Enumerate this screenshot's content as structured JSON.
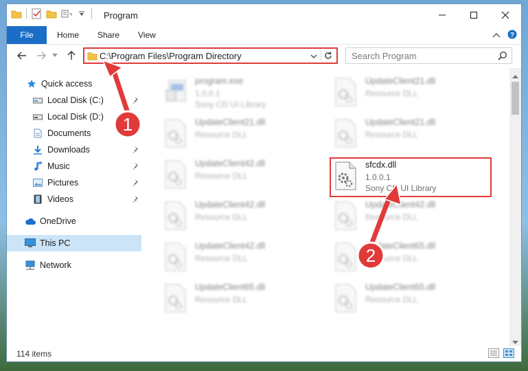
{
  "window": {
    "title": "Program"
  },
  "ribbon": {
    "tabs": [
      "File",
      "Home",
      "Share",
      "View"
    ]
  },
  "address": {
    "path": "C:\\Program Files\\Program Directory"
  },
  "search": {
    "placeholder": "Search Program"
  },
  "nav": {
    "items": [
      {
        "label": "Quick access",
        "icon": "star-icon"
      },
      {
        "label": "Local Disk (C:)",
        "icon": "drive-icon"
      },
      {
        "label": "Local Disk (D:)",
        "icon": "drive-icon"
      },
      {
        "label": "Documents",
        "icon": "documents-icon"
      },
      {
        "label": "Downloads",
        "icon": "downloads-icon"
      },
      {
        "label": "Music",
        "icon": "music-icon"
      },
      {
        "label": "Pictures",
        "icon": "pictures-icon"
      },
      {
        "label": "Videos",
        "icon": "videos-icon"
      },
      {
        "label": "OneDrive",
        "icon": "cloud-icon"
      },
      {
        "label": "This PC",
        "icon": "computer-icon",
        "selected": true
      },
      {
        "label": "Network",
        "icon": "network-icon"
      }
    ]
  },
  "files": [
    {
      "name": "program.exe",
      "line2": "1.0.0.1",
      "line3": "Sony CD UI Library"
    },
    {
      "name": "UpdateClient21.dll",
      "line2": "Resource DLL"
    },
    {
      "name": "UpdateClient21.dll",
      "line2": "Resource DLL"
    },
    {
      "name": "UpdateClient21.dll",
      "line2": "Resource DLL"
    },
    {
      "name": "UpdateClient42.dll",
      "line2": "Resource DLL"
    },
    {
      "name": "sfcdx.dll",
      "line2": "1.0.0.1",
      "line3": "Sony CD UI Library"
    },
    {
      "name": "UpdateClient42.dll",
      "line2": "Resource DLL"
    },
    {
      "name": "UpdateClient42.dll",
      "line2": "Resource DLL"
    },
    {
      "name": "UpdateClient42.dll",
      "line2": "Resource DLL"
    },
    {
      "name": "UpdateClient65.dll",
      "line2": "Resource DLL"
    },
    {
      "name": "UpdateClient65.dll",
      "line2": "Resource DLL"
    },
    {
      "name": "UpdateClient65.dll",
      "line2": "Resource DLL"
    }
  ],
  "status": {
    "count": "114 items"
  },
  "annotations": {
    "marker1": "1",
    "marker2": "2"
  },
  "colors": {
    "accent": "#1a6ec6",
    "highlight": "#e03a3a",
    "selected": "#cce4f7"
  }
}
